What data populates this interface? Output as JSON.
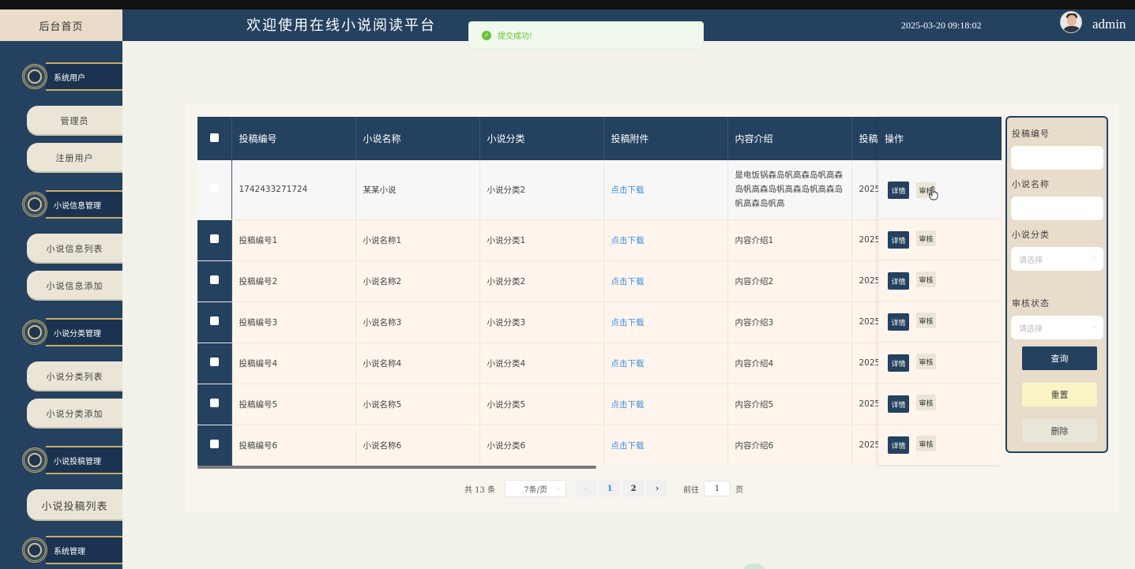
{
  "header": {
    "home_tab": "后台首页",
    "site_title": "欢迎使用在线小说阅读平台",
    "datetime": "2025-03-20 09:18:02",
    "username": "admin"
  },
  "toast": {
    "message": "提交成功!"
  },
  "sidebar": {
    "groups": [
      {
        "title": "系统用户",
        "items": [
          "管理员",
          "注册用户"
        ]
      },
      {
        "title": "小说信息管理",
        "items": [
          "小说信息列表",
          "小说信息添加"
        ]
      },
      {
        "title": "小说分类管理",
        "items": [
          "小说分类列表",
          "小说分类添加"
        ]
      },
      {
        "title": "小说投稿管理",
        "items": [
          "小说投稿列表"
        ]
      },
      {
        "title": "系统管理",
        "items": []
      }
    ]
  },
  "table": {
    "columns": [
      "投稿编号",
      "小说名称",
      "小说分类",
      "投稿附件",
      "内容介绍",
      "投稿",
      "操作"
    ],
    "rows": [
      {
        "id": "1742433271724",
        "name": "某某小说",
        "category": "小说分类2",
        "attachment": "点击下载",
        "intro": "是电饭锅森岛帆高森岛帆高森岛帆高森岛帆高森岛帆高森岛帆高森岛帆高",
        "date": "2025"
      },
      {
        "id": "投稿编号1",
        "name": "小说名称1",
        "category": "小说分类1",
        "attachment": "点击下载",
        "intro": "内容介绍1",
        "date": "2025"
      },
      {
        "id": "投稿编号2",
        "name": "小说名称2",
        "category": "小说分类2",
        "attachment": "点击下载",
        "intro": "内容介绍2",
        "date": "2025"
      },
      {
        "id": "投稿编号3",
        "name": "小说名称3",
        "category": "小说分类3",
        "attachment": "点击下载",
        "intro": "内容介绍3",
        "date": "2025"
      },
      {
        "id": "投稿编号4",
        "name": "小说名称4",
        "category": "小说分类4",
        "attachment": "点击下载",
        "intro": "内容介绍4",
        "date": "2025"
      },
      {
        "id": "投稿编号5",
        "name": "小说名称5",
        "category": "小说分类5",
        "attachment": "点击下载",
        "intro": "内容介绍5",
        "date": "2025"
      },
      {
        "id": "投稿编号6",
        "name": "小说名称6",
        "category": "小说分类6",
        "attachment": "点击下载",
        "intro": "内容介绍6",
        "date": "2025"
      }
    ],
    "ops": {
      "detail": "详情",
      "audit": "审核"
    }
  },
  "pagination": {
    "total": "共 13 条",
    "page_size": "7条/页",
    "pages": [
      "1",
      "2"
    ],
    "current": "1",
    "goto_prefix": "前往",
    "goto_value": "1",
    "goto_suffix": "页"
  },
  "search": {
    "labels": {
      "submission_id": "投稿编号",
      "novel_name": "小说名称",
      "category": "小说分类",
      "status": "审核状态"
    },
    "select_placeholder": "请选择",
    "buttons": {
      "query": "查询",
      "reset": "重置",
      "delete": "删除"
    }
  },
  "colors": {
    "navy": "#24415f",
    "beige": "#eadcc9",
    "link": "#3a8de0",
    "success": "#67c23a"
  }
}
